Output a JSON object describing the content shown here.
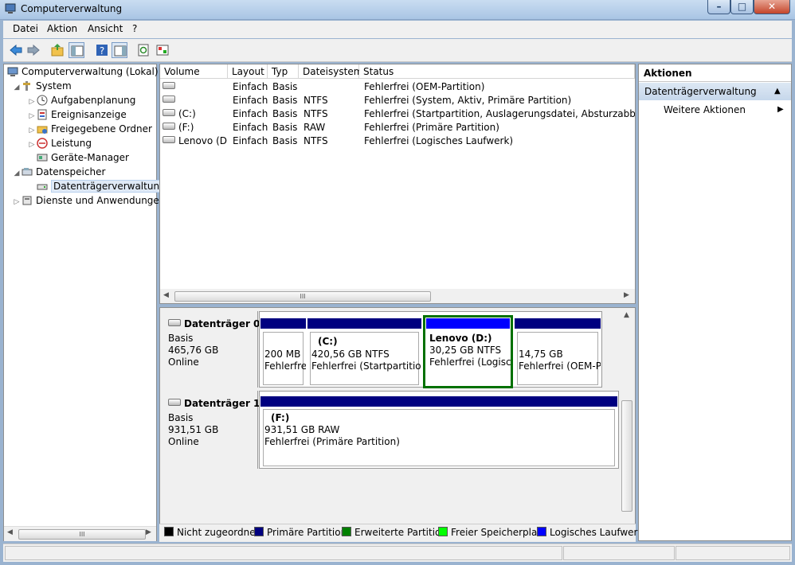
{
  "window": {
    "title": "Computerverwaltung"
  },
  "menu": [
    "Datei",
    "Aktion",
    "Ansicht",
    "?"
  ],
  "tree": {
    "root": "Computerverwaltung (Lokal)",
    "system": "System",
    "aufgaben": "Aufgabenplanung",
    "ereignis": "Ereignisanzeige",
    "freigaben": "Freigegebene Ordner",
    "leistung": "Leistung",
    "geraete": "Geräte-Manager",
    "speicher": "Datenspeicher",
    "datentraeger": "Datenträgerverwaltung",
    "dienste": "Dienste und Anwendungen"
  },
  "list": {
    "headers": [
      "Volume",
      "Layout",
      "Typ",
      "Dateisystem",
      "Status"
    ],
    "rows": [
      [
        "",
        "Einfach",
        "Basis",
        "",
        "Fehlerfrei (OEM-Partition)"
      ],
      [
        "",
        "Einfach",
        "Basis",
        "NTFS",
        "Fehlerfrei (System, Aktiv, Primäre Partition)"
      ],
      [
        "(C:)",
        "Einfach",
        "Basis",
        "NTFS",
        "Fehlerfrei (Startpartition, Auslagerungsdatei, Absturzabbild, Prim"
      ],
      [
        "(F:)",
        "Einfach",
        "Basis",
        "RAW",
        "Fehlerfrei (Primäre Partition)"
      ],
      [
        "Lenovo (D:)",
        "Einfach",
        "Basis",
        "NTFS",
        "Fehlerfrei (Logisches Laufwerk)"
      ]
    ],
    "scroll_glyph": "III"
  },
  "disk0": {
    "name": "Datenträger 0",
    "type": "Basis",
    "size": "465,76 GB",
    "state": "Online",
    "parts": [
      {
        "line1": "",
        "line2": "200 MB",
        "line3": "Fehlerfrei"
      },
      {
        "line1": "(C:)",
        "line2": "420,56 GB NTFS",
        "line3": "Fehlerfrei (Startpartition,"
      },
      {
        "line1": "Lenovo  (D:)",
        "line2": "30,25 GB NTFS",
        "line3": "Fehlerfrei (Logisc"
      },
      {
        "line1": "",
        "line2": "14,75 GB",
        "line3": "Fehlerfrei (OEM-P"
      }
    ]
  },
  "disk1": {
    "name": "Datenträger 1",
    "type": "Basis",
    "size": "931,51 GB",
    "state": "Online",
    "part": {
      "line1": "(F:)",
      "line2": "931,51 GB RAW",
      "line3": "Fehlerfrei (Primäre Partition)"
    }
  },
  "legend": [
    {
      "label": "Nicht zugeordnet",
      "color": "#000000"
    },
    {
      "label": "Primäre Partition",
      "color": "#000080"
    },
    {
      "label": "Erweiterte Partition",
      "color": "#008000"
    },
    {
      "label": "Freier Speicherplatz",
      "color": "#00ff00"
    },
    {
      "label": "Logisches Laufwerk",
      "color": "#0000ff"
    }
  ],
  "actions": {
    "header": "Aktionen",
    "section": "Datenträgerverwaltung",
    "more": "Weitere Aktionen"
  },
  "tree_scroll_glyph": "III"
}
